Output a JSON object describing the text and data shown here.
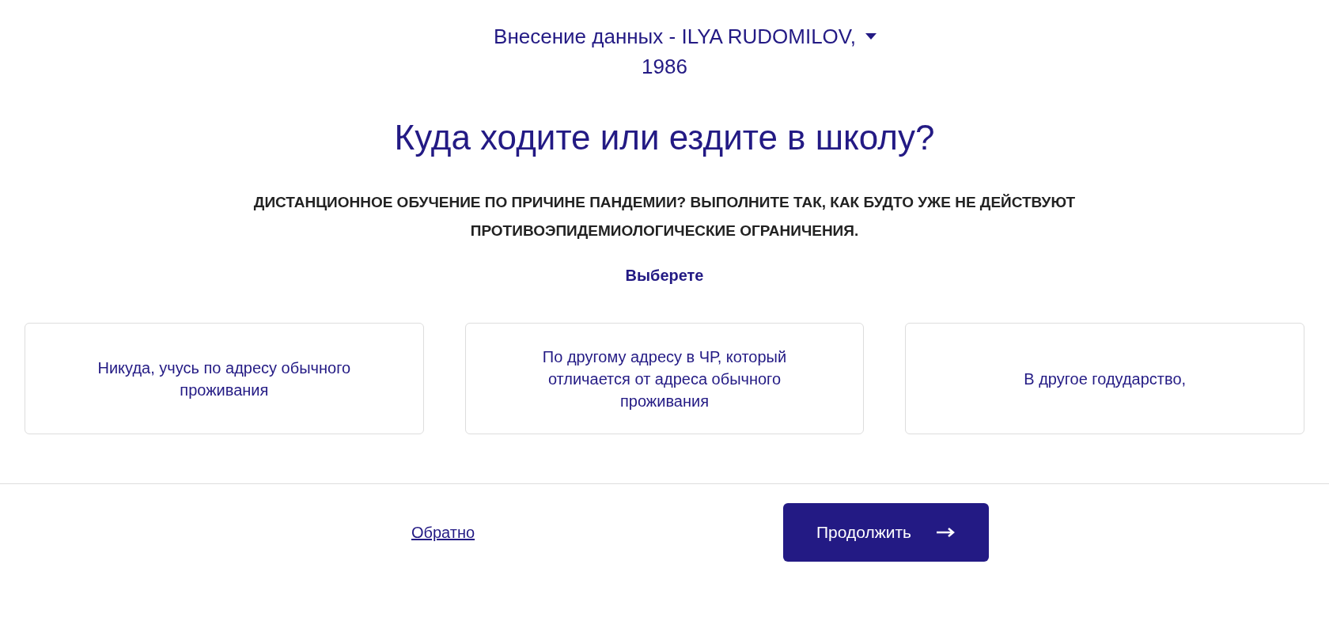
{
  "header": {
    "title": "Внесение данных - ILYA RUDOMILOV,",
    "subtitle": "1986"
  },
  "question": "Куда ходите или ездите в школу?",
  "notice": "ДИСТАНЦИОННОЕ ОБУЧЕНИЕ ПО ПРИЧИНЕ ПАНДЕМИИ? ВЫПОЛНИТЕ ТАК, КАК БУДТО УЖЕ НЕ ДЕЙСТВУЮТ ПРОТИВОЭПИДЕМИОЛОГИЧЕСКИЕ ОГРАНИЧЕНИЯ.",
  "prompt": "Выберете",
  "options": [
    {
      "label": "Никуда, учусь по адресу обычного проживания",
      "selected": false
    },
    {
      "label": "По другому адресу в ЧР, который отличается от адреса обычного проживания",
      "selected": false
    },
    {
      "label": "В другое годударство,",
      "selected": false
    }
  ],
  "footer": {
    "back": "Обратно",
    "next": "Продолжить"
  }
}
